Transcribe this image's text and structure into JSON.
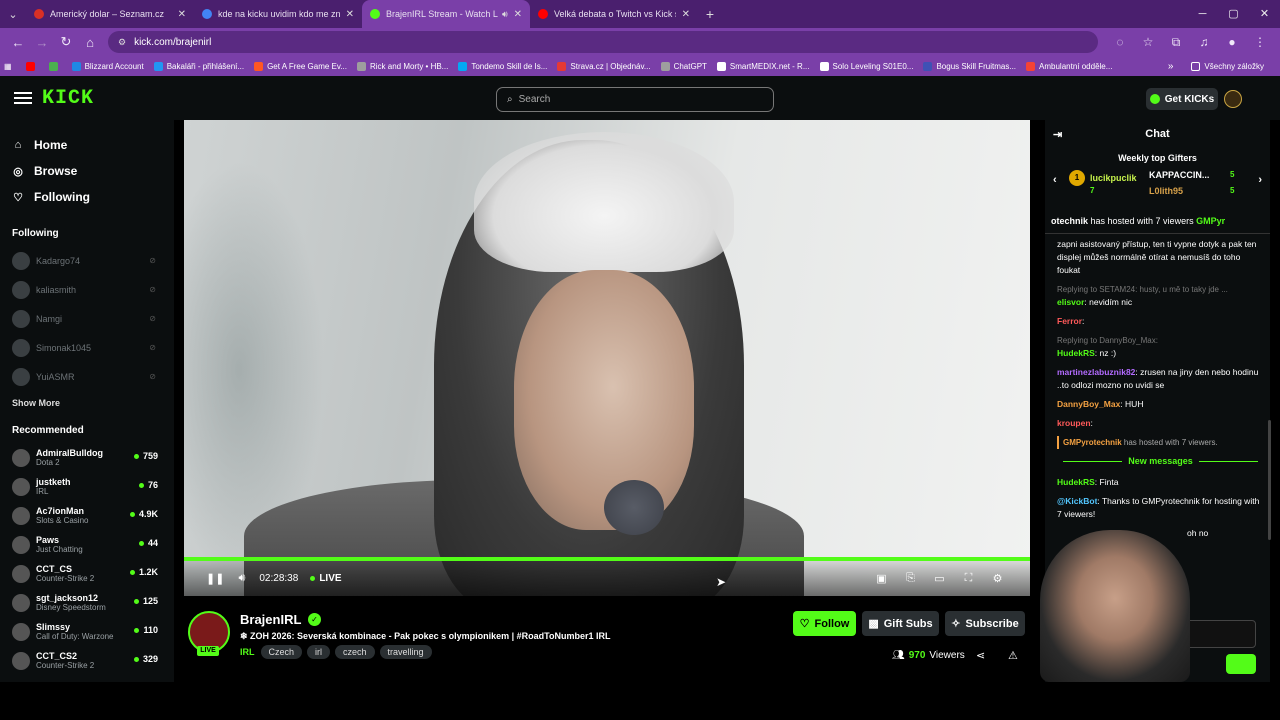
{
  "browser": {
    "tabs": [
      {
        "title": "Americký dolar – Seznam.cz",
        "color": "#d93025"
      },
      {
        "title": "kde na kicku uvidim kdo me zn",
        "color": "#4285f4"
      },
      {
        "title": "BrajenIRL Stream - Watch Li",
        "color": "#53fc18"
      },
      {
        "title": "Velká debata o Twitch vs Kick s",
        "color": "#ff0000"
      }
    ],
    "url": "kick.com/brajenirl",
    "bookmarks": [
      {
        "label": "Blizzard Account",
        "color": "#1e88e5"
      },
      {
        "label": "Bakaláři - přihlášení...",
        "color": "#2196f3"
      },
      {
        "label": "Get A Free Game Ev...",
        "color": "#ff5722"
      },
      {
        "label": "Rick and Morty • HB...",
        "color": "#9e9e9e"
      },
      {
        "label": "Tondemo Skill de Is...",
        "color": "#03a9f4"
      },
      {
        "label": "Strava.cz | Objednáv...",
        "color": "#e53935"
      },
      {
        "label": "ChatGPT",
        "color": "#9e9e9e"
      },
      {
        "label": "SmartMEDIX.net - R...",
        "color": "#fff"
      },
      {
        "label": "Solo Leveling S01E0...",
        "color": "#fff"
      },
      {
        "label": "Bogus Skill Fruitmas...",
        "color": "#3f51b5"
      },
      {
        "label": "Ambulantní odděle...",
        "color": "#f44336"
      }
    ],
    "all_bookmarks": "Všechny záložky"
  },
  "header": {
    "logo": "KICK",
    "search_placeholder": "Search",
    "get_kicks": "Get KICKs"
  },
  "sidebar": {
    "nav": [
      {
        "label": "Home",
        "icon": "⌂"
      },
      {
        "label": "Browse",
        "icon": "◎"
      },
      {
        "label": "Following",
        "icon": "♡"
      }
    ],
    "following_title": "Following",
    "following": [
      "Kadargo74",
      "kaliasmith",
      "Namgi",
      "Simonak1045",
      "YuiASMR"
    ],
    "show_more": "Show More",
    "recommended_title": "Recommended",
    "recommended": [
      {
        "name": "AdmiralBulldog",
        "game": "Dota 2",
        "viewers": "759"
      },
      {
        "name": "justketh",
        "game": "IRL",
        "viewers": "76"
      },
      {
        "name": "Ac7ionMan",
        "game": "Slots & Casino",
        "viewers": "4.9K"
      },
      {
        "name": "Paws",
        "game": "Just Chatting",
        "viewers": "44"
      },
      {
        "name": "CCT_CS",
        "game": "Counter-Strike 2",
        "viewers": "1.2K"
      },
      {
        "name": "sgt_jackson12",
        "game": "Disney Speedstorm",
        "viewers": "125"
      },
      {
        "name": "Slimssy",
        "game": "Call of Duty: Warzone",
        "viewers": "110"
      },
      {
        "name": "CCT_CS2",
        "game": "Counter-Strike 2",
        "viewers": "329"
      }
    ]
  },
  "player": {
    "time": "02:28:38",
    "live_label": "LIVE",
    "progress_fraction": 1.0
  },
  "channel": {
    "name": "BrajenIRL",
    "live_badge": "LIVE",
    "title": "❄ ZOH 2026: Severská kombinace - Pak pokec s olympionikem | #RoadToNumber1 IRL",
    "category": "IRL",
    "tags": [
      "Czech",
      "irl",
      "czech",
      "travelling"
    ],
    "follow": "Follow",
    "gift_subs": "Gift Subs",
    "subscribe": "Subscribe",
    "viewers": "970",
    "viewers_label": "Viewers"
  },
  "chat": {
    "title": "Chat",
    "gifters_title": "Weekly top Gifters",
    "gifter1": {
      "name": "lucikpuclik",
      "count": "7"
    },
    "gifter2": {
      "name": "KAPPACCIN...",
      "count": "5"
    },
    "gifter3": {
      "name": "L0lith95",
      "count": "5"
    },
    "pinned_user": "otechnik",
    "pinned_text": " has hosted with 7 viewers ",
    "pinned_user2": "GMPyr",
    "messages": [
      {
        "reply": "",
        "user": "",
        "user_class": "u1",
        "text": "zapni asistovaný přístup, ten ti vypne dotyk a pak ten displej můžeš normálně otírat a nemusíš do toho foukat"
      },
      {
        "reply": "Replying to SETAM24: husty, u mě to taky jde ...",
        "user": "elisvor",
        "user_class": "u1",
        "text": ": nevidím nic"
      },
      {
        "reply": "",
        "user": "Ferror",
        "user_class": "u2",
        "text": ":"
      },
      {
        "reply": "Replying to DannyBoy_Max:",
        "user": "HudekRS",
        "user_class": "u1",
        "text": ": nz :)"
      },
      {
        "reply": "",
        "user": "martinezlabuznik82",
        "user_class": "u3",
        "text": ": zrusen na jiny den nebo hodinu ..to odlozi mozno no uvidi se"
      },
      {
        "reply": "",
        "user": "DannyBoy_Max",
        "user_class": "u4",
        "text": ": HUH"
      },
      {
        "reply": "",
        "user": "kroupen",
        "user_class": "u2",
        "text": ":"
      }
    ],
    "host_notice_user": "GMPyrotechnik",
    "host_notice_text": " has hosted with 7 viewers.",
    "new_messages": "New messages",
    "new_msgs": [
      {
        "user": "HudekRS",
        "user_class": "u1",
        "text": ": Finta"
      },
      {
        "user": "@KickBot",
        "user_class": "u5",
        "text": ": Thanks to GMPyrotechnik for hosting with 7 viewers!"
      }
    ],
    "partial_text": "oh no"
  }
}
